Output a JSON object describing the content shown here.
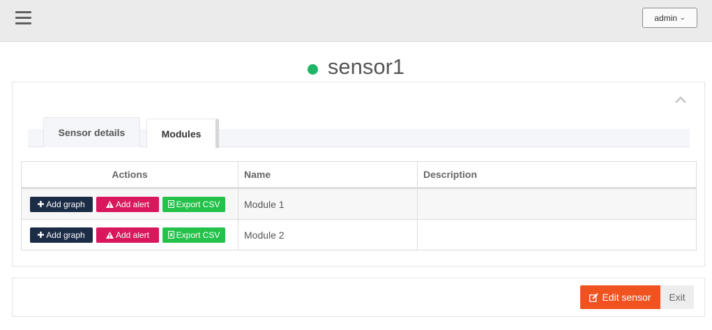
{
  "header": {
    "menu_icon": "hamburger-menu-icon",
    "user_label": "admin",
    "user_dropdown_icon": "chevron-down-icon"
  },
  "sensor": {
    "title": "sensor1",
    "status_color": "#1fb566"
  },
  "panel": {
    "collapse_icon": "chevron-up-icon"
  },
  "tabs": [
    {
      "label": "Sensor details",
      "active": false
    },
    {
      "label": "Modules",
      "active": true
    }
  ],
  "table": {
    "headers": [
      "Actions",
      "Name",
      "Description"
    ],
    "actions": {
      "add_graph": "Add graph",
      "add_alert": "Add alert",
      "export_csv": "Export CSV"
    },
    "rows": [
      {
        "name": "Module 1",
        "description": ""
      },
      {
        "name": "Module 2",
        "description": ""
      }
    ]
  },
  "footer": {
    "edit_label": "Edit sensor",
    "exit_label": "Exit"
  },
  "colors": {
    "add_graph": "#1b2c47",
    "add_alert": "#d8175c",
    "export_csv": "#25c24b",
    "edit": "#f0531f"
  }
}
